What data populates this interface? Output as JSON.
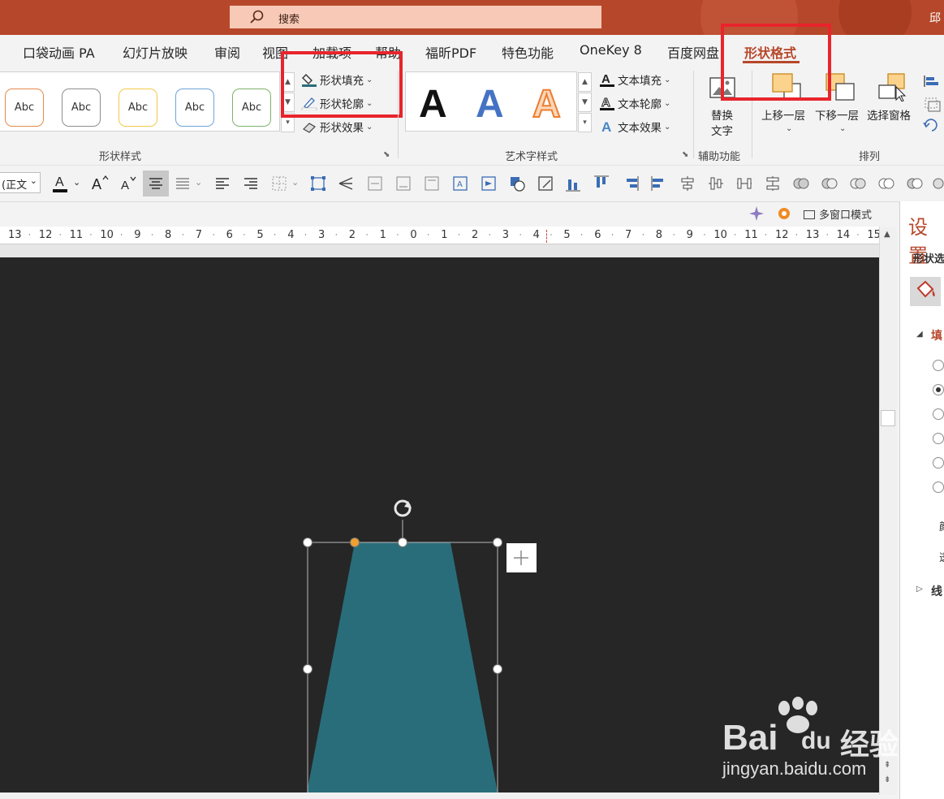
{
  "title_bar": {
    "search_placeholder": "搜索",
    "user": "邱 "
  },
  "tabs": [
    "口袋动画 PA",
    "幻灯片放映",
    "审阅",
    "视图",
    "加载项",
    "帮助",
    "福昕PDF",
    "特色功能",
    "OneKey 8",
    "百度网盘",
    "形状格式"
  ],
  "ribbon": {
    "shape_styles": {
      "group_label": "形状样式",
      "gallery": [
        {
          "label": "Abc",
          "border": "#e68a4c"
        },
        {
          "label": "Abc",
          "border": "#8e8e8e"
        },
        {
          "label": "Abc",
          "border": "#f2c94c"
        },
        {
          "label": "Abc",
          "border": "#6fa3d8"
        },
        {
          "label": "Abc",
          "border": "#7fb36a"
        }
      ],
      "fill": "形状填充",
      "outline": "形状轮廓",
      "effects": "形状效果"
    },
    "wordart_styles": {
      "group_label": "艺术字样式",
      "samples": [
        {
          "label": "A",
          "color": "#111111"
        },
        {
          "label": "A",
          "color": "#4472c4"
        },
        {
          "label": "A",
          "color": "#ed7d31"
        }
      ],
      "text_fill": "文本填充",
      "text_outline": "文本轮廓",
      "text_effects": "文本效果"
    },
    "accessibility": {
      "group_label": "辅助功能",
      "alt_text": "替换\n文字",
      "alt_text_line1": "替换",
      "alt_text_line2": "文字"
    },
    "arrange": {
      "group_label": "排列",
      "bring_forward": "上移一层",
      "send_backward": "下移一层",
      "selection_pane": "选择窗格"
    }
  },
  "format_bar": {
    "font_size": "(正文"
  },
  "view_strip": {
    "multiwindow": "多窗口模式"
  },
  "ruler": {
    "ticks": [
      "13",
      "12",
      "11",
      "10",
      "9",
      "8",
      "7",
      "6",
      "5",
      "4",
      "3",
      "2",
      "1",
      "0",
      "1",
      "2",
      "3",
      "4",
      "5",
      "6",
      "7",
      "8",
      "9",
      "10",
      "11",
      "12",
      "13",
      "14",
      "15"
    ]
  },
  "pane": {
    "title": "设置",
    "subtitle": "形状选",
    "section_fill": "填",
    "label1": "颜",
    "label2": "透",
    "section_line": "线"
  },
  "colors": {
    "accent": "#b7472a",
    "shape": "#296d7a",
    "canvas": "#262626",
    "highlight": "#e8242c"
  },
  "watermark": {
    "brand": "Bai",
    "brand_du": "du",
    "brand_cn": "经验",
    "url": "jingyan.baidu.com"
  }
}
